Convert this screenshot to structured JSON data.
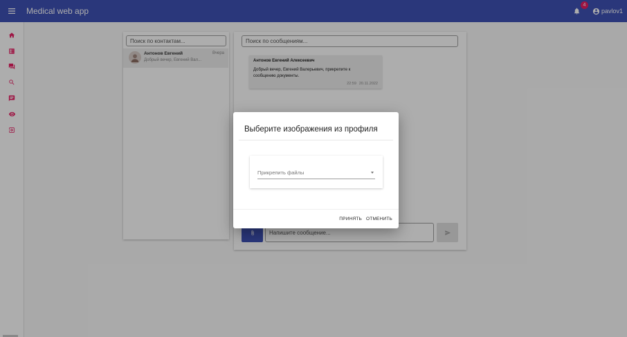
{
  "toolbar": {
    "title": "Medical web app",
    "notifications_count": "4",
    "username": "pavlov1",
    "color": "#3f51b5"
  },
  "sidebar": {
    "accent": "#e91e63",
    "items": [
      {
        "icon": "home-icon"
      },
      {
        "icon": "dashboard-icon"
      },
      {
        "icon": "forum-icon"
      },
      {
        "icon": "search-icon"
      },
      {
        "icon": "chat-icon"
      },
      {
        "icon": "eye-icon"
      },
      {
        "icon": "logout-icon"
      }
    ]
  },
  "contacts": {
    "search_placeholder": "Поиск по контактам...",
    "items": [
      {
        "name": "Антонов Евгений",
        "time": "Вчера",
        "preview": "Добрый вечер, Евгений Вал..."
      }
    ]
  },
  "chat": {
    "search_placeholder": "Поиск по сообщениям...",
    "message": {
      "author": "Антонов Евгений Алексеевич",
      "text": "Добрый вечер, Евгений Валерьевич, прикрепите к сообщению документы.",
      "time": "22:59",
      "date": "20.11.2022"
    },
    "input_placeholder": "Напишите сообщение..."
  },
  "dialog": {
    "title": "Выберите изображения из профиля",
    "select_placeholder": "Прикрепить файлы",
    "accept_label": "ПРИНЯТЬ",
    "cancel_label": "ОТМЕНИТЬ"
  }
}
